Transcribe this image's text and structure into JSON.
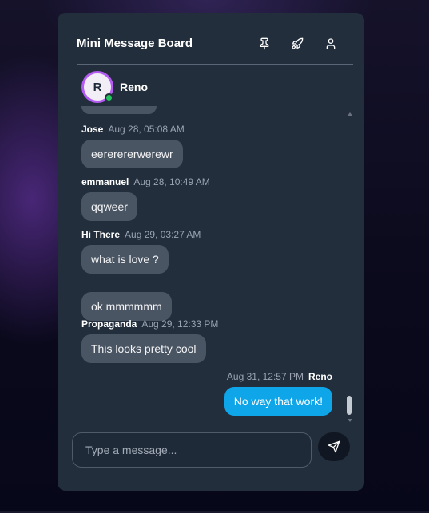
{
  "app": {
    "title": "Mini Message Board",
    "header_icons": [
      "pin-icon",
      "rocket-icon",
      "user-icon"
    ]
  },
  "current_user": {
    "initial": "R",
    "name": "Reno",
    "status": "online"
  },
  "messages": [
    {
      "sender": "Jose",
      "time": "Aug 28, 05:08 AM",
      "text": "eererererwerewr"
    },
    {
      "sender": "emmanuel",
      "time": "Aug 28, 10:49 AM",
      "text": "qqweer"
    },
    {
      "sender": "Hi There",
      "time": "Aug 29, 03:27 AM",
      "text": "what is love ?"
    },
    {
      "text": "ok mmmmmm"
    },
    {
      "sender": "Propaganda",
      "time": "Aug 29, 12:33 PM",
      "text": "This looks pretty cool"
    },
    {
      "sender": "Reno",
      "time": "Aug 31, 12:57 PM",
      "text": "No way that work!",
      "mine": true
    }
  ],
  "composer": {
    "placeholder": "Type a message...",
    "value": ""
  },
  "colors": {
    "card": "#222e3c",
    "bubble_other": "#4a5563",
    "bubble_mine": "#0ea5e9",
    "avatar_ring": "#b45cf2",
    "online": "#22c55e"
  }
}
